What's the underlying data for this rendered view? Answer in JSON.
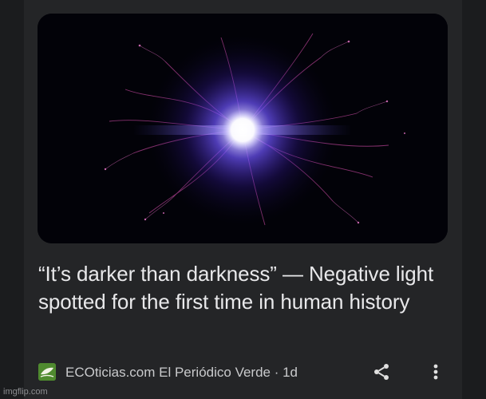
{
  "article": {
    "headline": "“It’s darker than darkness” — Negative light spotted for the first time in human history",
    "source": "ECOticias.com El Periódico Verde · 1d",
    "favicon_icon": "leaf-logo-icon"
  },
  "actions": {
    "share_icon": "share-icon",
    "more_icon": "more-vert-icon"
  },
  "watermark": "imgflip.com",
  "colors": {
    "background": "#1b1c1e",
    "card": "#242527",
    "headline_text": "#e8e8ea",
    "source_text": "#c9cacc",
    "icon": "#e0e0e0",
    "favicon": "#4f8a2f"
  }
}
